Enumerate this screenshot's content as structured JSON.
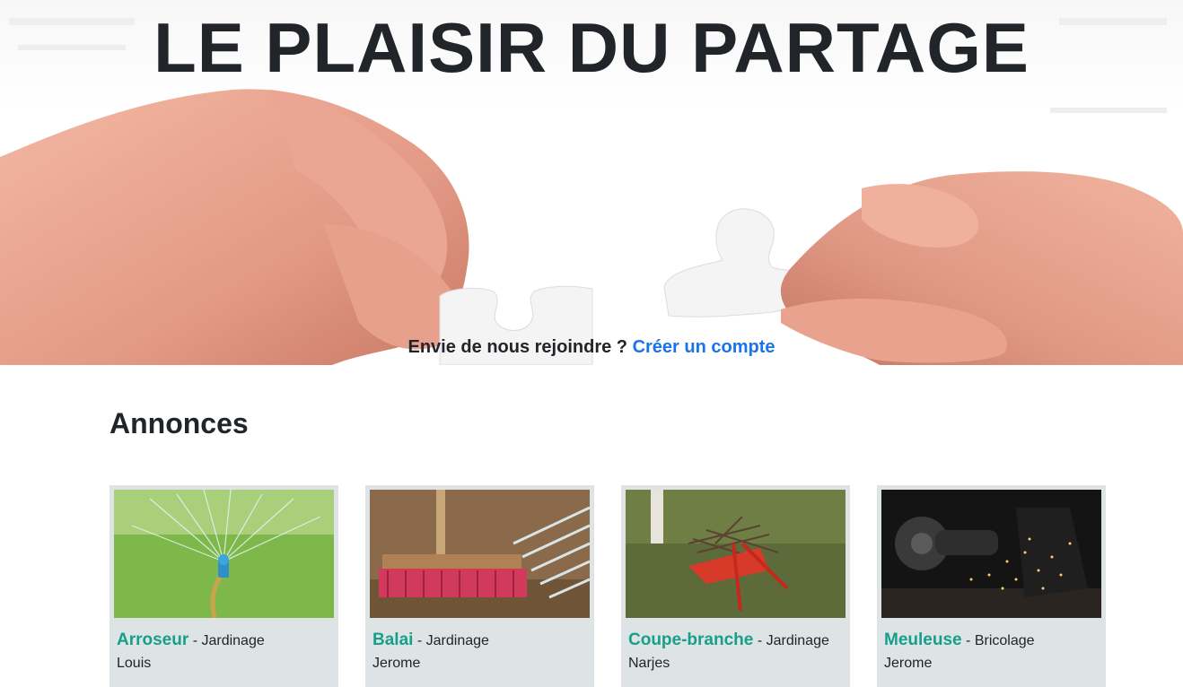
{
  "hero": {
    "title": "LE PLAISIR DU PARTAGE",
    "cta_text": "Envie de nous rejoindre ?",
    "cta_link": "Créer un compte"
  },
  "annonces": {
    "title": "Annonces",
    "items": [
      {
        "name": "Arroseur",
        "separator": "- Jardinage",
        "user": "Louis",
        "image": "sprinkler-image"
      },
      {
        "name": "Balai",
        "separator": "- Jardinage",
        "user": "Jerome",
        "image": "broom-image"
      },
      {
        "name": "Coupe-branche",
        "separator": "- Jardinage",
        "user": "Narjes",
        "image": "branch-cutter-image"
      },
      {
        "name": "Meuleuse",
        "separator": "- Bricolage",
        "user": "Jerome",
        "image": "grinder-image"
      }
    ]
  },
  "colors": {
    "link": "#1a73e8",
    "item_name": "#16a08a",
    "card_bg": "#dee3e6",
    "text": "#212529"
  }
}
